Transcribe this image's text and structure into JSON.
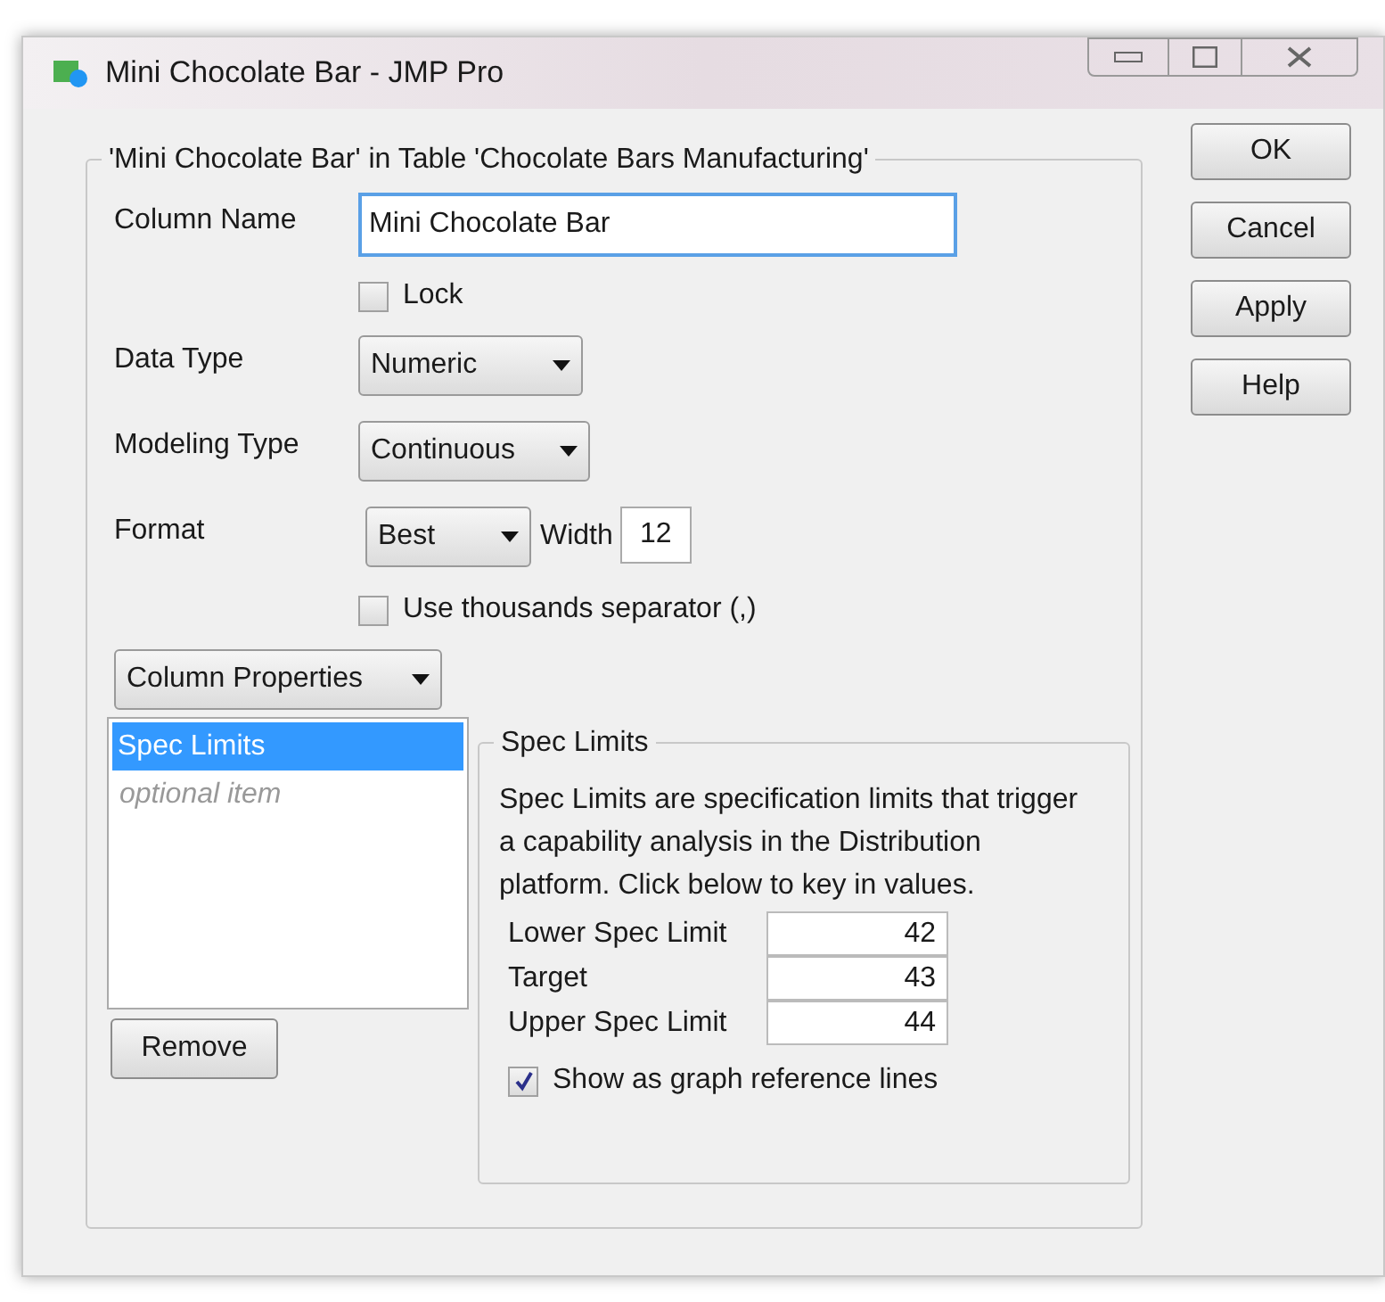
{
  "window": {
    "title": "Mini Chocolate Bar - JMP Pro"
  },
  "group_title": "'Mini Chocolate Bar' in Table 'Chocolate Bars Manufacturing'",
  "column_name": {
    "label": "Column Name",
    "value": "Mini Chocolate Bar"
  },
  "lock": {
    "label": "Lock",
    "checked": false
  },
  "data_type": {
    "label": "Data Type",
    "value": "Numeric"
  },
  "modeling_type": {
    "label": "Modeling Type",
    "value": "Continuous"
  },
  "format": {
    "label": "Format",
    "value": "Best",
    "width_label": "Width",
    "width_value": "12"
  },
  "thousands_separator": {
    "label": "Use thousands separator (,)",
    "checked": false
  },
  "column_properties": {
    "label": "Column Properties"
  },
  "properties_list": {
    "items": [
      {
        "label": "Spec Limits",
        "selected": true
      }
    ],
    "optional_entry": "optional item"
  },
  "remove_button": "Remove",
  "spec_limits": {
    "title": "Spec Limits",
    "description": "Spec Limits are specification limits that trigger a capability analysis in the Distribution platform. Click below to key in values.",
    "limits": [
      {
        "label": "Lower Spec Limit",
        "value": "42"
      },
      {
        "label": "Target",
        "value": "43"
      },
      {
        "label": "Upper Spec Limit",
        "value": "44"
      }
    ],
    "show_lines": {
      "label": "Show as graph reference lines",
      "checked": true
    }
  },
  "buttons": [
    "OK",
    "Cancel",
    "Apply",
    "Help"
  ]
}
